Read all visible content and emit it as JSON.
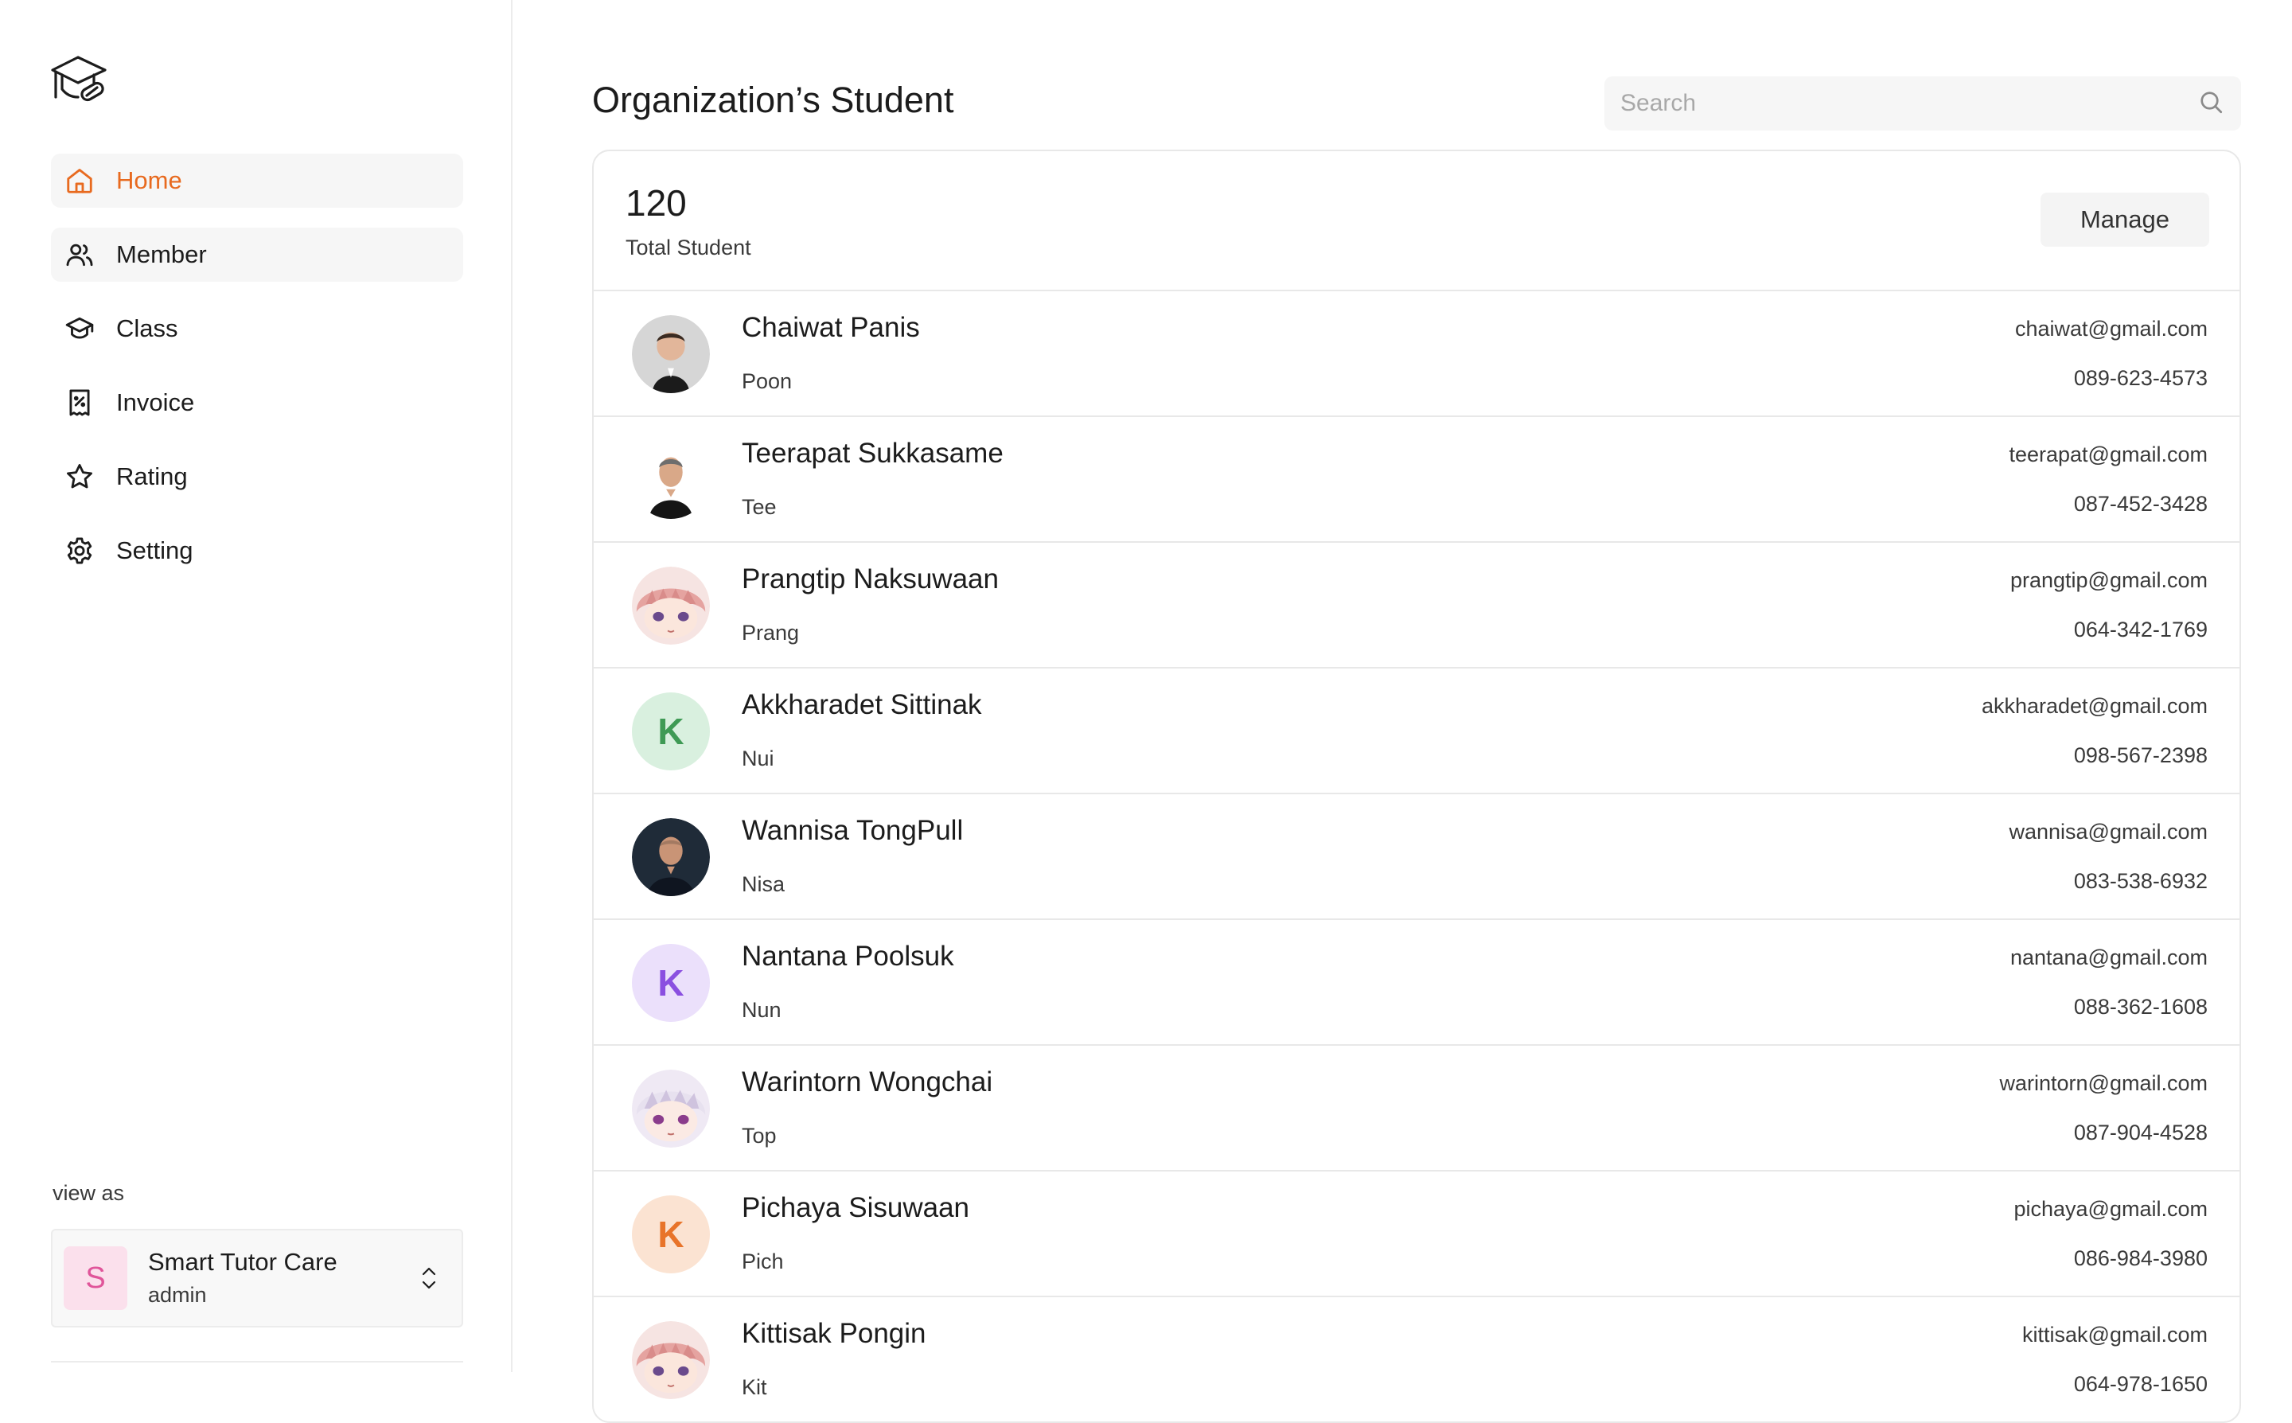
{
  "sidebar": {
    "nav": [
      {
        "label": "Home",
        "icon": "home-icon"
      },
      {
        "label": "Member",
        "icon": "users-icon"
      },
      {
        "label": "Class",
        "icon": "graduation-cap-icon"
      },
      {
        "label": "Invoice",
        "icon": "receipt-icon"
      },
      {
        "label": "Rating",
        "icon": "star-icon"
      },
      {
        "label": "Setting",
        "icon": "gear-icon"
      }
    ],
    "view_as_label": "view as",
    "org": {
      "initial": "S",
      "name": "Smart Tutor Care",
      "role": "admin"
    }
  },
  "header": {
    "title": "Organization’s Student",
    "search_placeholder": "Search"
  },
  "summary": {
    "total": "120",
    "total_label": "Total Student",
    "manage_label": "Manage"
  },
  "students": [
    {
      "name": "Chaiwat Panis",
      "nickname": "Poon",
      "email": "chaiwat@gmail.com",
      "phone": "089-623-4573",
      "avatar": "photo-man-red"
    },
    {
      "name": "Teerapat Sukkasame",
      "nickname": "Tee",
      "email": "teerapat@gmail.com",
      "phone": "087-452-3428",
      "avatar": "photo-man-white"
    },
    {
      "name": "Prangtip Naksuwaan",
      "nickname": "Prang",
      "email": "prangtip@gmail.com",
      "phone": "064-342-1769",
      "avatar": "anime-pink"
    },
    {
      "name": "Akkharadet Sittinak",
      "nickname": "Nui",
      "email": "akkharadet@gmail.com",
      "phone": "098-567-2398",
      "avatar_letter": "K",
      "avatar_bg": "#d9f0df",
      "avatar_fg": "#3f9a55"
    },
    {
      "name": "Wannisa TongPull",
      "nickname": "Nisa",
      "email": "wannisa@gmail.com",
      "phone": "083-538-6932",
      "avatar": "photo-man-dark"
    },
    {
      "name": "Nantana Poolsuk",
      "nickname": "Nun",
      "email": "nantana@gmail.com",
      "phone": "088-362-1608",
      "avatar_letter": "K",
      "avatar_bg": "#ebe0fb",
      "avatar_fg": "#8a4fe0"
    },
    {
      "name": "Warintorn Wongchai",
      "nickname": "Top",
      "email": "warintorn@gmail.com",
      "phone": "087-904-4528",
      "avatar": "anime-lilac"
    },
    {
      "name": "Pichaya Sisuwaan",
      "nickname": "Pich",
      "email": "pichaya@gmail.com",
      "phone": "086-984-3980",
      "avatar_letter": "K",
      "avatar_bg": "#fbe3d2",
      "avatar_fg": "#e8742a"
    },
    {
      "name": "Kittisak Pongin",
      "nickname": "Kit",
      "email": "kittisak@gmail.com",
      "phone": "064-978-1650",
      "avatar": "anime-pink"
    }
  ],
  "colors": {
    "accent": "#e86a1f",
    "border": "#e8e8e8",
    "muted_bg": "#f6f6f6"
  }
}
